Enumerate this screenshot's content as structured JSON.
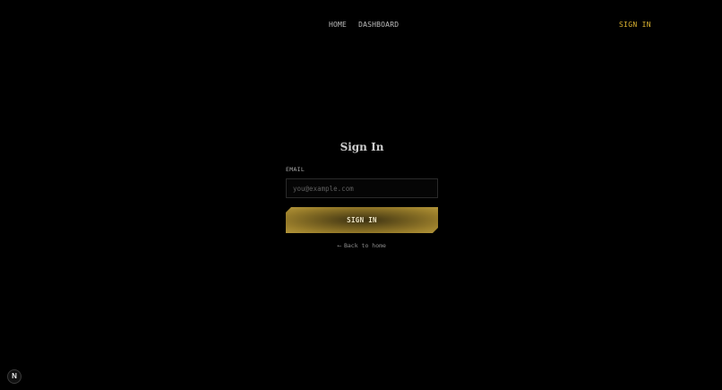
{
  "nav": {
    "links": [
      {
        "label": "HOME"
      },
      {
        "label": "DASHBOARD"
      }
    ],
    "signin_label": "SIGN IN"
  },
  "form": {
    "title": "Sign In",
    "email_label": "EMAIL",
    "email_placeholder": "you@example.com",
    "email_value": "",
    "submit_label": "SIGN IN",
    "back_arrow": "⟵",
    "back_label": "Back to home"
  },
  "badge": {
    "letter": "N",
    "icon": "nextjs-logo-icon"
  },
  "colors": {
    "background": "#000000",
    "accent": "#d9b130",
    "button_gold": "#b2953a",
    "text": "#c9c9c9"
  }
}
